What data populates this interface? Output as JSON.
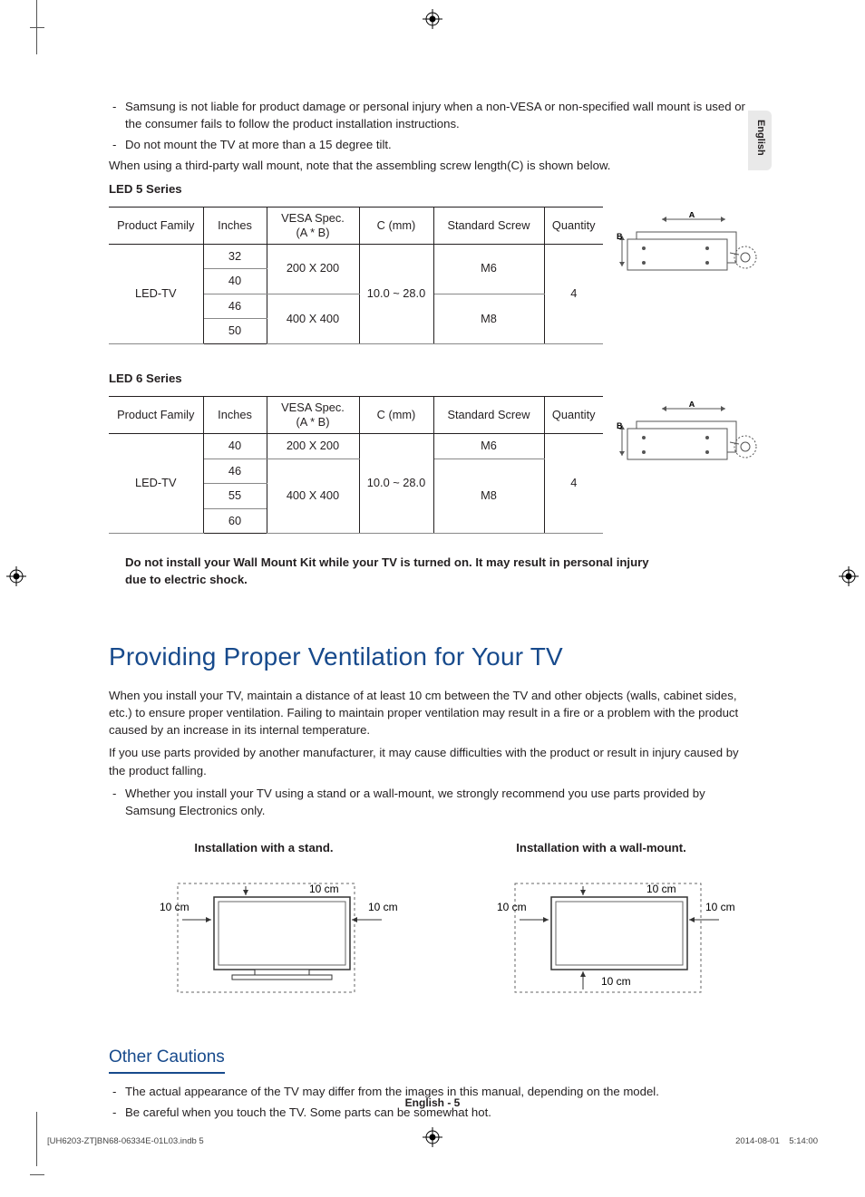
{
  "language_tab": "English",
  "intro": {
    "bullets": [
      "Samsung is not liable for product damage or personal injury when a non-VESA or non-specified wall mount is used or the consumer fails to follow the product installation instructions.",
      "Do not mount the TV at more than a 15 degree tilt."
    ],
    "para": "When using a third-party wall mount, note that the assembling screw length(C) is shown below."
  },
  "tables": {
    "headers": {
      "family": "Product Family",
      "inches": "Inches",
      "vesa": "VESA Spec.\n(A * B)",
      "c": "C (mm)",
      "screw": "Standard Screw",
      "qty": "Quantity"
    },
    "series5": {
      "label": "LED 5 Series",
      "family": "LED-TV",
      "rows": {
        "i32": "32",
        "i40": "40",
        "i46": "46",
        "i50": "50",
        "vesa_a": "200 X 200",
        "vesa_b": "400 X 400",
        "c": "10.0 ~ 28.0",
        "screw_a": "M6",
        "screw_b": "M8",
        "qty": "4"
      }
    },
    "series6": {
      "label": "LED 6 Series",
      "family": "LED-TV",
      "rows": {
        "i40": "40",
        "i46": "46",
        "i55": "55",
        "i60": "60",
        "vesa_a": "200 X 200",
        "vesa_b": "400 X 400",
        "c": "10.0 ~ 28.0",
        "screw_a": "M6",
        "screw_b": "M8",
        "qty": "4"
      }
    },
    "diagram_labels": {
      "A": "A",
      "B": "B"
    }
  },
  "warning": "Do not install your Wall Mount Kit while your TV is turned on. It may result in personal injury due to electric shock.",
  "ventilation": {
    "heading": "Providing Proper Ventilation for Your TV",
    "p1": "When you install your TV, maintain a distance of at least 10 cm between the TV and other objects (walls, cabinet sides, etc.) to ensure proper ventilation. Failing to maintain proper ventilation may result in a fire or a problem with the product caused by an increase in its internal temperature.",
    "p2": "If you use parts provided by another manufacturer, it may cause difficulties with the product or result in injury caused by the product falling.",
    "bullet": "Whether you install your TV using a stand or a wall-mount, we strongly recommend you use parts provided by Samsung Electronics only.",
    "stand_title": "Installation with a stand.",
    "wall_title": "Installation with a wall-mount.",
    "dist": "10 cm"
  },
  "other": {
    "heading": "Other Cautions",
    "bullets": [
      "The actual appearance of the TV may differ from the images in this manual, depending on the model.",
      "Be careful when you touch the TV. Some parts can be somewhat hot."
    ]
  },
  "footer": {
    "center": "English - 5",
    "left": "[UH6203-ZT]BN68-06334E-01L03.indb   5",
    "right": "2014-08-01     5:14:00"
  }
}
